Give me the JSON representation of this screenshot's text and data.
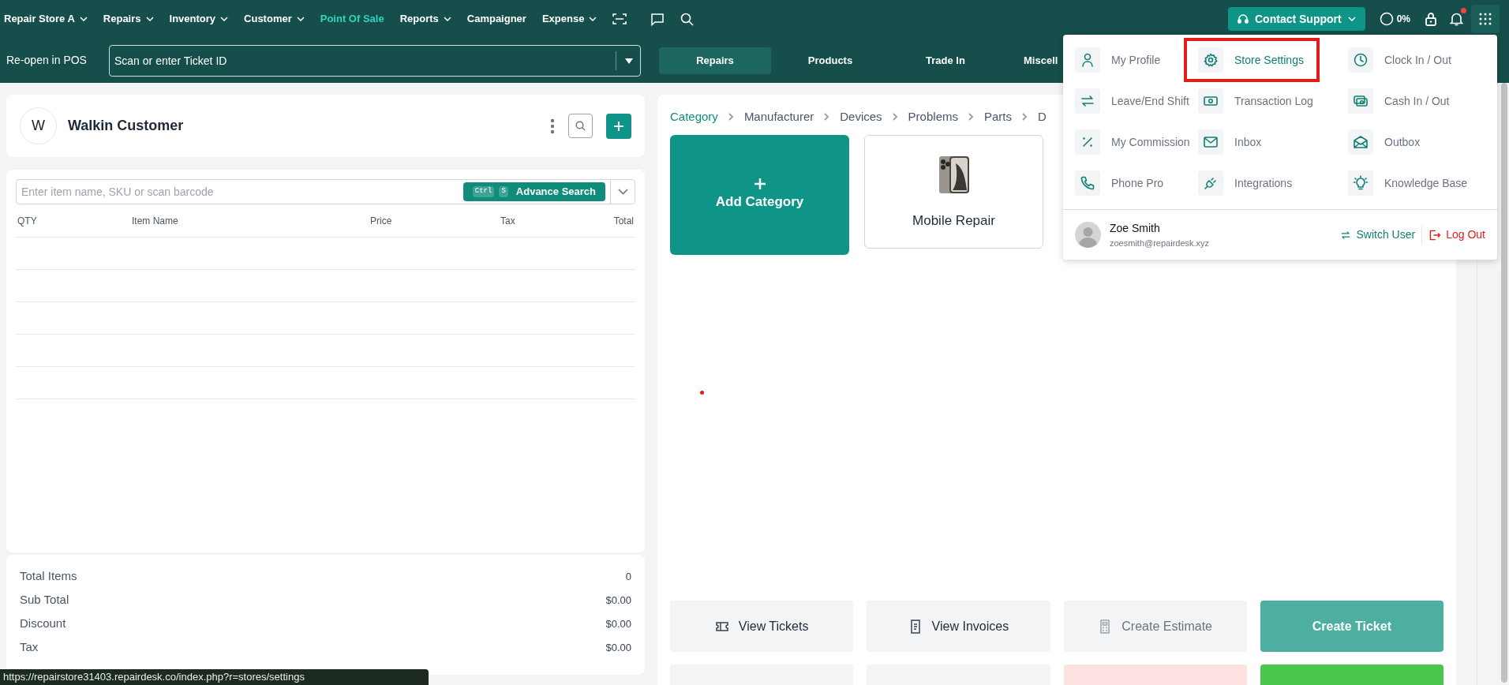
{
  "nav": {
    "items": [
      {
        "label": "Repair Store A",
        "dropdown": true,
        "selected": false
      },
      {
        "label": "Repairs",
        "dropdown": true,
        "selected": false
      },
      {
        "label": "Inventory",
        "dropdown": true,
        "selected": false
      },
      {
        "label": "Customer",
        "dropdown": true,
        "selected": false
      },
      {
        "label": "Point Of Sale",
        "dropdown": false,
        "selected": true
      },
      {
        "label": "Reports",
        "dropdown": true,
        "selected": false
      },
      {
        "label": "Campaigner",
        "dropdown": false,
        "selected": false
      },
      {
        "label": "Expense",
        "dropdown": true,
        "selected": false
      }
    ],
    "contact_support": "Contact Support",
    "progress": "0%",
    "notifications_unread": true
  },
  "reopen": {
    "label": "Re-open in POS",
    "placeholder": "Scan or enter Ticket ID"
  },
  "pos_tabs": [
    {
      "label": "Repairs",
      "selected": true
    },
    {
      "label": "Products",
      "selected": false
    },
    {
      "label": "Trade In",
      "selected": false
    },
    {
      "label": "Miscell",
      "selected": false
    }
  ],
  "customer": {
    "initial": "W",
    "name": "Walkin Customer"
  },
  "item_search": {
    "placeholder": "Enter item name, SKU or scan barcode",
    "keys": [
      "Ctrl",
      "S"
    ],
    "button": "Advance Search"
  },
  "cart": {
    "columns": [
      "QTY",
      "Item Name",
      "Price",
      "Tax",
      "Total"
    ]
  },
  "totals": [
    {
      "label": "Total Items",
      "value": "0"
    },
    {
      "label": "Sub Total",
      "value": "$0.00"
    },
    {
      "label": "Discount",
      "value": "$0.00"
    },
    {
      "label": "Tax",
      "value": "$0.00"
    }
  ],
  "breadcrumb": [
    {
      "label": "Category",
      "selected": true
    },
    {
      "label": "Manufacturer",
      "selected": false
    },
    {
      "label": "Devices",
      "selected": false
    },
    {
      "label": "Problems",
      "selected": false
    },
    {
      "label": "Parts",
      "selected": false
    },
    {
      "label": "D",
      "selected": false
    }
  ],
  "categories": [
    {
      "kind": "add",
      "label": "Add Category"
    },
    {
      "kind": "device",
      "label": "Mobile Repair"
    }
  ],
  "actions": [
    {
      "kind": "tickets",
      "label": "View Tickets",
      "color": "#f3f4f6"
    },
    {
      "kind": "invoices",
      "label": "View Invoices",
      "color": "#f3f4f6"
    },
    {
      "kind": "estimate",
      "label": "Create Estimate",
      "color": "#f3f4f6"
    },
    {
      "kind": "plain",
      "label": "Create Ticket",
      "color": "#4caf9f"
    },
    {
      "kind": "blank",
      "color": "#f3f4f6"
    },
    {
      "kind": "blank",
      "color": "#f3f4f6"
    },
    {
      "kind": "blank",
      "color": "#fde2e2"
    },
    {
      "kind": "blank",
      "color": "#4cc54c"
    }
  ],
  "user_menu": {
    "items": [
      {
        "kind": "user",
        "label": "My Profile",
        "highlighted": false
      },
      {
        "kind": "gear",
        "label": "Store Settings",
        "highlighted": true
      },
      {
        "kind": "clock",
        "label": "Clock In / Out",
        "highlighted": false
      },
      {
        "kind": "swap",
        "label": "Leave/End Shift",
        "highlighted": false
      },
      {
        "kind": "cash",
        "label": "Transaction Log",
        "highlighted": false
      },
      {
        "kind": "cashbox",
        "label": "Cash In / Out",
        "highlighted": false
      },
      {
        "kind": "percent",
        "label": "My Commission",
        "highlighted": false
      },
      {
        "kind": "mail",
        "label": "Inbox",
        "highlighted": false
      },
      {
        "kind": "mailopen",
        "label": "Outbox",
        "highlighted": false
      },
      {
        "kind": "phone",
        "label": "Phone Pro",
        "highlighted": false
      },
      {
        "kind": "plug",
        "label": "Integrations",
        "highlighted": false
      },
      {
        "kind": "bulb",
        "label": "Knowledge Base",
        "highlighted": false
      }
    ],
    "user": {
      "name": "Zoe Smith",
      "email": "zoesmith@repairdesk.xyz"
    },
    "switch_user": "Switch User",
    "log_out": "Log Out"
  },
  "status_url": "https://repairstore31403.repairdesk.co/index.php?r=stores/settings"
}
